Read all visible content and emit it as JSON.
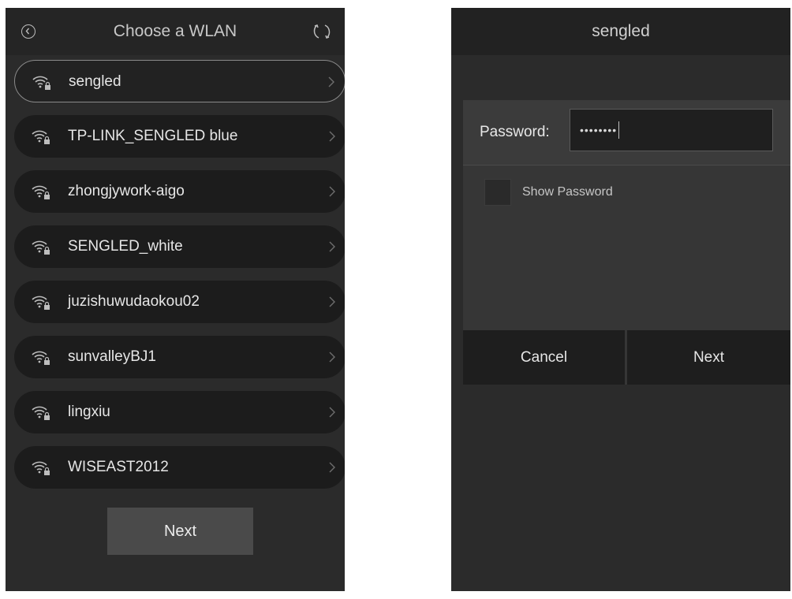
{
  "left_screen": {
    "header": {
      "title": "Choose a WLAN",
      "back_icon": "back-circle-icon",
      "refresh_icon": "refresh-icon"
    },
    "networks": [
      {
        "name": "sengled",
        "selected": true
      },
      {
        "name": "TP-LINK_SENGLED blue",
        "selected": false
      },
      {
        "name": "zhongjywork-aigo",
        "selected": false
      },
      {
        "name": "SENGLED_white",
        "selected": false
      },
      {
        "name": "juzishuwudaokou02",
        "selected": false
      },
      {
        "name": "sunvalleyBJ1",
        "selected": false
      },
      {
        "name": "lingxiu",
        "selected": false
      },
      {
        "name": "WISEAST2012",
        "selected": false
      }
    ],
    "next_label": "Next"
  },
  "right_screen": {
    "title": "sengled",
    "password": {
      "label": "Password:",
      "value": "••••••••"
    },
    "show_password_label": "Show Password",
    "cancel_label": "Cancel",
    "next_label": "Next"
  }
}
